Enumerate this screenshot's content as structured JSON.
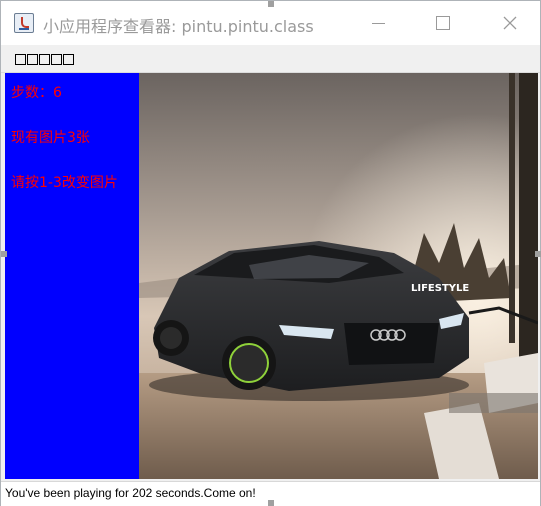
{
  "window": {
    "title": "小应用程序查看器: pintu.pintu.class",
    "minimize_label": "",
    "maximize_label": "",
    "close_label": ""
  },
  "menu": {
    "applet_menu_label": "□□□□□"
  },
  "panel": {
    "steps": "步数：6",
    "picture_count": "现有图片3张",
    "instruction": "请按1-3改变图片"
  },
  "picture": {
    "logo_text": "LIFESTYLE"
  },
  "status": {
    "message": "You've been playing for 202 seconds.Come on!"
  },
  "colors": {
    "panel_background": "#0000ff",
    "panel_text": "#ff0000"
  }
}
